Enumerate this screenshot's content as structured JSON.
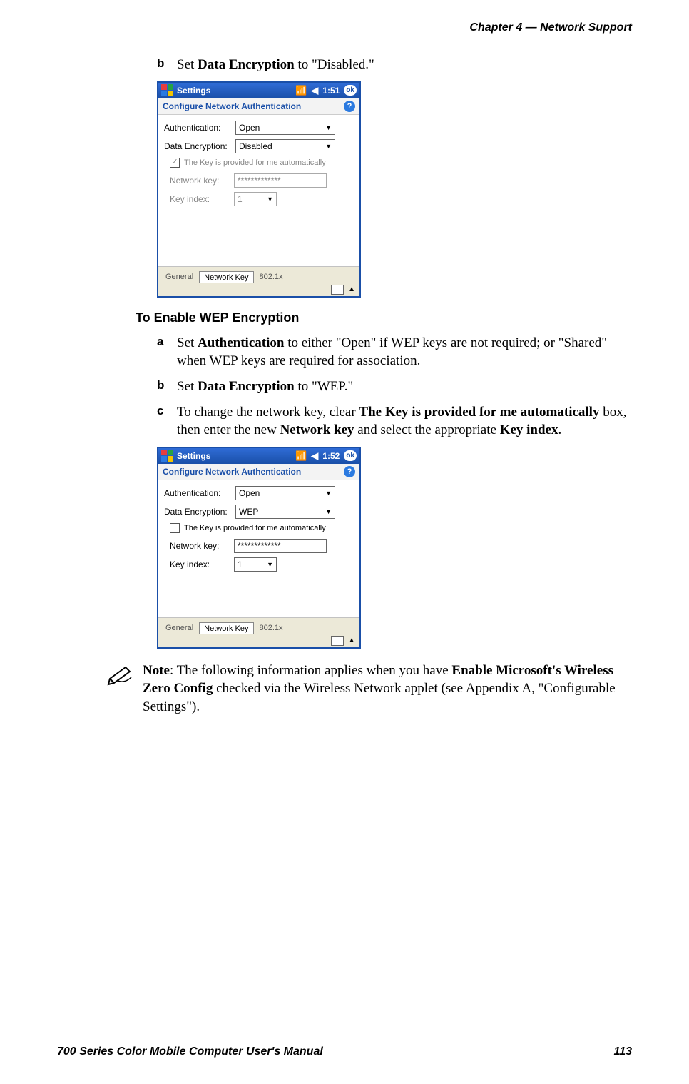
{
  "header": {
    "text": "Chapter  4  —  Network Support"
  },
  "step_b_top": {
    "marker": "b",
    "pre": "Set ",
    "bold": "Data Encryption",
    "post": " to \"Disabled.\""
  },
  "shot1": {
    "title": "Settings",
    "time": "1:51",
    "ok": "ok",
    "subbar": "Configure Network Authentication",
    "auth_label": "Authentication:",
    "auth_value": "Open",
    "enc_label": "Data Encryption:",
    "enc_value": "Disabled",
    "auto_label": "The Key is provided for me automatically",
    "auto_checked": true,
    "key_label": "Network key:",
    "key_value": "*************",
    "idx_label": "Key index:",
    "idx_value": "1",
    "tabs": {
      "t1": "General",
      "t2": "Network Key",
      "t3": "802.1x"
    }
  },
  "section_heading": "To Enable WEP Encryption",
  "step_a": {
    "marker": "a",
    "pre": "Set ",
    "bold": "Authentication",
    "post1": " to either \"Open\" if WEP keys are not required; or \"Shared\" when WEP keys are required for association."
  },
  "step_b": {
    "marker": "b",
    "pre": "Set ",
    "bold": "Data Encryption",
    "post": " to \"WEP.\""
  },
  "step_c": {
    "marker": "c",
    "t1": "To change the network key, clear ",
    "b1": "The Key is provided for me automatically",
    "t2": " box, then enter the new ",
    "b2": "Network key",
    "t3": " and select the appropriate ",
    "b3": "Key index",
    "t4": "."
  },
  "shot2": {
    "title": "Settings",
    "time": "1:52",
    "ok": "ok",
    "subbar": "Configure Network Authentication",
    "auth_label": "Authentication:",
    "auth_value": "Open",
    "enc_label": "Data Encryption:",
    "enc_value": "WEP",
    "auto_label": "The Key is provided for me automatically",
    "auto_checked": false,
    "key_label": "Network key:",
    "key_value": "*************",
    "idx_label": "Key index:",
    "idx_value": "1",
    "tabs": {
      "t1": "General",
      "t2": "Network Key",
      "t3": "802.1x"
    }
  },
  "note": {
    "b1": "Note",
    "t1": ": The following information applies when you have ",
    "b2": "Enable Microsoft's Wireless Zero Config",
    "t2": " checked via the Wireless Network applet (see Appendix A, \"Configurable Settings\")."
  },
  "footer": {
    "left": "700 Series Color Mobile Computer User's Manual",
    "right": "113"
  },
  "icons": {
    "caret": "▼",
    "help": "?",
    "triup": "▲",
    "signal": "📶",
    "speaker": "◀"
  }
}
